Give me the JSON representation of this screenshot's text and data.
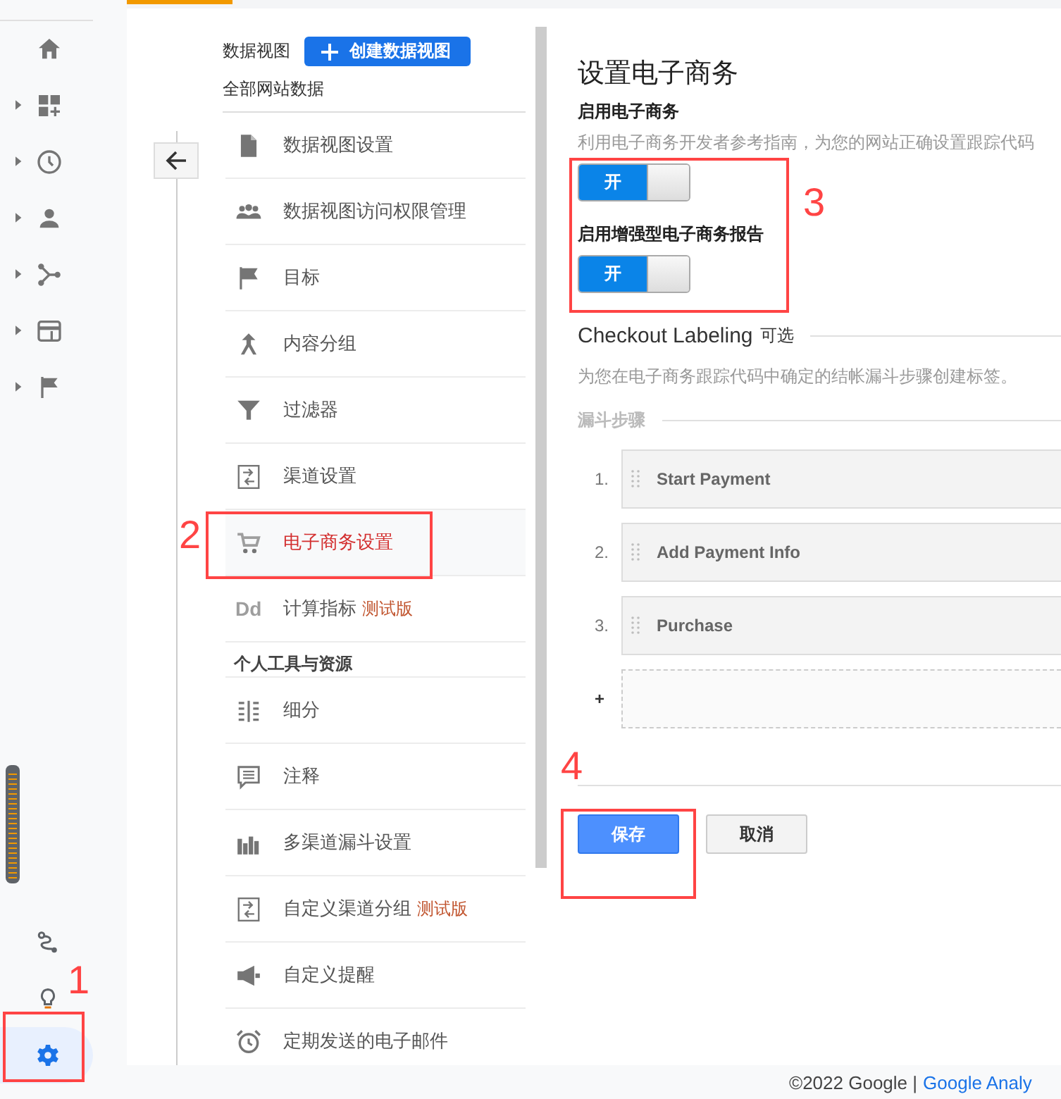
{
  "nav_rail": {
    "groups": [
      {
        "expanded": false
      },
      {
        "expanded": false
      },
      {
        "expanded": false
      },
      {
        "expanded": false
      },
      {
        "expanded": false
      },
      {
        "expanded": false
      }
    ],
    "bottom_items": [
      {
        "selected": false
      },
      {
        "selected": false
      },
      {
        "selected": true
      }
    ]
  },
  "view_header": {
    "label": "数据视图",
    "create_button": "创建数据视图",
    "view_name": "全部网站数据"
  },
  "menu": [
    {
      "kind": "item",
      "label": "数据视图设置",
      "selected": false
    },
    {
      "kind": "item",
      "label": "数据视图访问权限管理",
      "selected": false
    },
    {
      "kind": "item",
      "label": "目标",
      "selected": false
    },
    {
      "kind": "item",
      "label": "内容分组",
      "selected": false
    },
    {
      "kind": "item",
      "label": "过滤器",
      "selected": false
    },
    {
      "kind": "item",
      "label": "渠道设置",
      "selected": false
    },
    {
      "kind": "item",
      "label": "电子商务设置",
      "selected": true
    },
    {
      "kind": "item",
      "label": "计算指标",
      "selected": false,
      "icon_text": "Dd",
      "badge": "测试版"
    },
    {
      "kind": "header",
      "label": "个人工具与资源"
    },
    {
      "kind": "item",
      "label": "细分",
      "selected": false
    },
    {
      "kind": "item",
      "label": "注释",
      "selected": false
    },
    {
      "kind": "item",
      "label": "多渠道漏斗设置",
      "selected": false
    },
    {
      "kind": "item",
      "label": "自定义渠道分组",
      "selected": false,
      "badge": "测试版"
    },
    {
      "kind": "item",
      "label": "自定义提醒",
      "selected": false
    },
    {
      "kind": "item",
      "label": "定期发送的电子邮件",
      "selected": false
    }
  ],
  "panel": {
    "title": "设置电子商务",
    "settings": [
      {
        "label": "启用电子商务",
        "description": "利用电子商务开发者参考指南，为您的网站正确设置跟踪代码",
        "toggle": {
          "on": true,
          "label": "开"
        }
      },
      {
        "label": "启用增强型电子商务报告",
        "toggle": {
          "on": true,
          "label": "开"
        }
      }
    ],
    "checkout": {
      "title": "Checkout Labeling",
      "optional": "可选",
      "description": "为您在电子商务跟踪代码中确定的结帐漏斗步骤创建标签。",
      "steps_title": "漏斗步骤",
      "steps": [
        {
          "number": "1.",
          "label": "Start Payment"
        },
        {
          "number": "2.",
          "label": "Add Payment Info"
        },
        {
          "number": "3.",
          "label": "Purchase"
        }
      ],
      "add_symbol": "+"
    },
    "buttons": {
      "save": "保存",
      "cancel": "取消"
    }
  },
  "footer": {
    "copyright": "©2022 Google |",
    "link": "Google Analy"
  },
  "annotations": [
    {
      "label": "1"
    },
    {
      "label": "2"
    },
    {
      "label": "3"
    },
    {
      "label": "4"
    }
  ]
}
